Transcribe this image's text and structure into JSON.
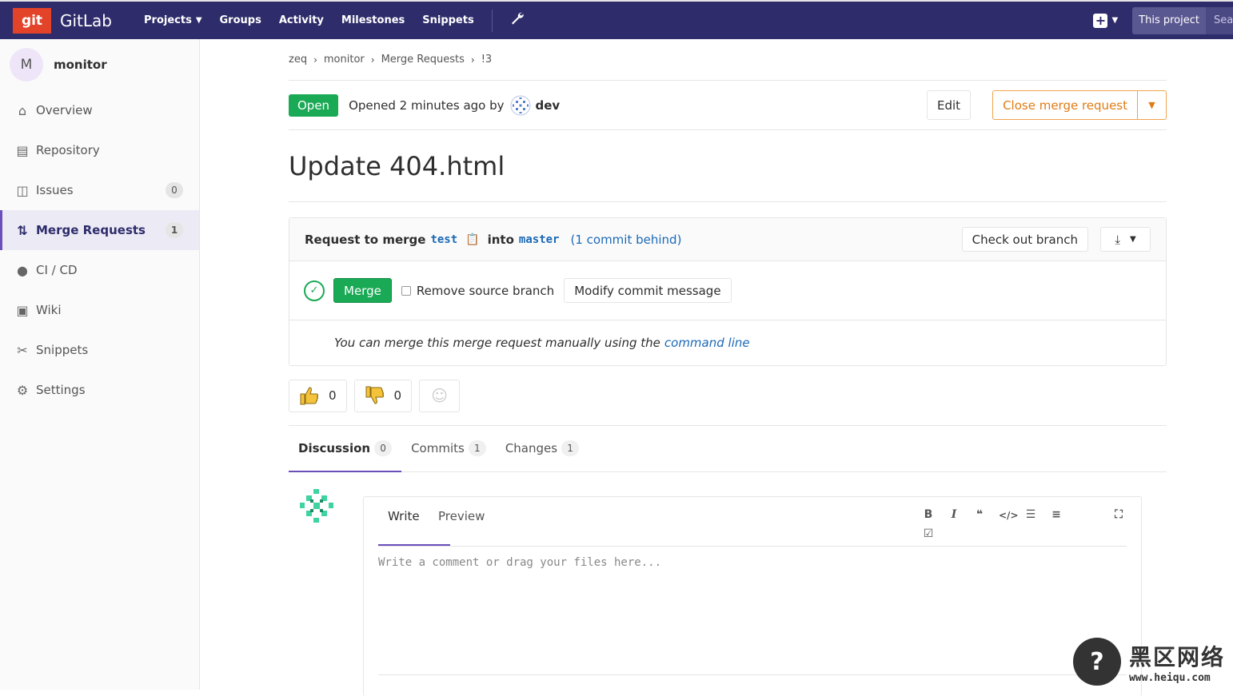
{
  "navbar": {
    "logo_text": "git",
    "brand": "GitLab",
    "links": [
      "Projects",
      "Groups",
      "Activity",
      "Milestones",
      "Snippets"
    ],
    "scope": "This project",
    "search_stub": "Sea"
  },
  "sidebar": {
    "avatar_letter": "M",
    "project": "monitor",
    "items": [
      {
        "label": "Overview",
        "icon": "home-icon"
      },
      {
        "label": "Repository",
        "icon": "doc-icon"
      },
      {
        "label": "Issues",
        "icon": "issues-icon",
        "count": "0"
      },
      {
        "label": "Merge Requests",
        "icon": "merge-icon",
        "count": "1"
      },
      {
        "label": "CI / CD",
        "icon": "rocket-icon"
      },
      {
        "label": "Wiki",
        "icon": "book-icon"
      },
      {
        "label": "Snippets",
        "icon": "scissors-icon"
      },
      {
        "label": "Settings",
        "icon": "gear-icon"
      }
    ]
  },
  "breadcrumb": [
    "zeq",
    "monitor",
    "Merge Requests",
    "!3"
  ],
  "mr": {
    "status": "Open",
    "opened_text": "Opened 2 minutes ago by",
    "author": "dev",
    "edit": "Edit",
    "close": "Close merge request",
    "title": "Update 404.html"
  },
  "widget": {
    "request_to_merge": "Request to merge",
    "source": "test",
    "into": "into",
    "target": "master",
    "behind": "(1 commit behind)",
    "checkout": "Check out branch",
    "merge": "Merge",
    "remove_source": "Remove source branch",
    "modify": "Modify commit message",
    "manual_text": "You can merge this merge request manually using the",
    "manual_link": "command line"
  },
  "awards": {
    "thumbsup": "0",
    "thumbsdown": "0"
  },
  "tabs": [
    {
      "label": "Discussion",
      "count": "0"
    },
    {
      "label": "Commits",
      "count": "1"
    },
    {
      "label": "Changes",
      "count": "1"
    }
  ],
  "editor": {
    "write": "Write",
    "preview": "Preview",
    "placeholder": "Write a comment or drag your files here..."
  },
  "watermark": {
    "cn": "黑区网络",
    "url": "www.heiqu.com"
  },
  "colors": {
    "navbar": "#2e2c6b",
    "success": "#1aaa55",
    "warning": "#e07c14",
    "link": "#1b69b6",
    "accent": "#6b4fbb"
  }
}
